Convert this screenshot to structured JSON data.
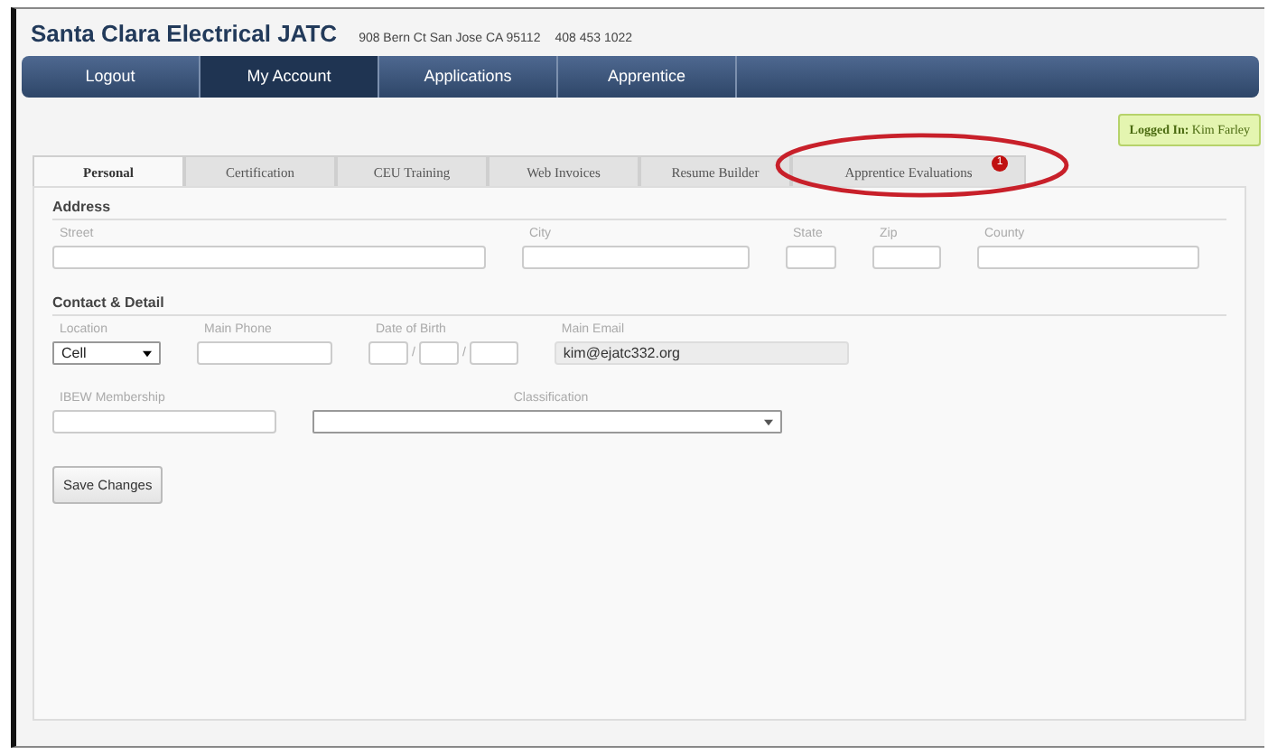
{
  "header": {
    "title": "Santa Clara Electrical JATC",
    "address": "908 Bern Ct San Jose CA 95112",
    "phone": "408 453 1022"
  },
  "nav": [
    {
      "label": "Logout",
      "selected": false
    },
    {
      "label": "My Account",
      "selected": true
    },
    {
      "label": "Applications",
      "selected": false
    },
    {
      "label": "Apprentice",
      "selected": false
    }
  ],
  "logged_in": {
    "label": "Logged In:",
    "user": "Kim Farley"
  },
  "tabs": [
    {
      "label": "Personal",
      "selected": true
    },
    {
      "label": "Certification",
      "selected": false
    },
    {
      "label": "CEU Training",
      "selected": false
    },
    {
      "label": "Web Invoices",
      "selected": false
    },
    {
      "label": "Resume Builder",
      "selected": false
    },
    {
      "label": "Apprentice Evaluations",
      "selected": false,
      "badge": "1",
      "circled": true
    }
  ],
  "address": {
    "heading": "Address",
    "fields": [
      {
        "label": "Street",
        "kind": "text"
      },
      {
        "label": "City",
        "kind": "text"
      },
      {
        "label": "State",
        "kind": "text"
      },
      {
        "label": "Zip",
        "kind": "text"
      },
      {
        "label": "County",
        "kind": "text"
      }
    ]
  },
  "contact": {
    "heading": "Contact & Detail",
    "fields": [
      {
        "label": "Location",
        "kind": "select",
        "value": "Cell"
      },
      {
        "label": "Main Phone",
        "kind": "text"
      },
      {
        "label": "Date of Birth",
        "kind": "date",
        "separators": [
          "/",
          "/"
        ]
      },
      {
        "label": "Main Email",
        "kind": "readonly",
        "value": "kim@ejatc332.org"
      }
    ],
    "fields2": [
      {
        "label": "IBEW Membership",
        "kind": "text"
      },
      {
        "label": "Classification",
        "kind": "select"
      }
    ]
  },
  "save_button": "Save Changes"
}
